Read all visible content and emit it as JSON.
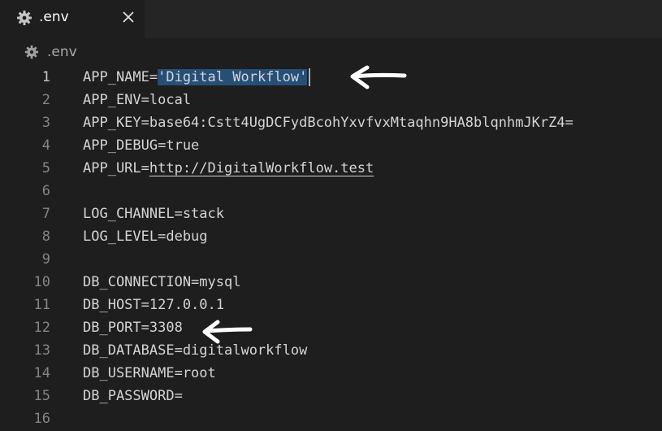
{
  "tab": {
    "title": ".env",
    "close_glyph": "✕",
    "icon": "gear-icon"
  },
  "breadcrumb": {
    "label": ".env",
    "icon": "gear-icon"
  },
  "editor": {
    "active_line": 1,
    "lines": [
      {
        "num": "1",
        "key": "APP_NAME=",
        "value": "'Digital Workflow'"
      },
      {
        "num": "2",
        "text": "APP_ENV=local"
      },
      {
        "num": "3",
        "text": "APP_KEY=base64:Cstt4UgDCFydBcohYxvfvxMtaqhn9HA8blqnhmJKrZ4="
      },
      {
        "num": "4",
        "text": "APP_DEBUG=true"
      },
      {
        "num": "5",
        "key": "APP_URL=",
        "value": "http://DigitalWorkflow.test"
      },
      {
        "num": "6",
        "text": ""
      },
      {
        "num": "7",
        "text": "LOG_CHANNEL=stack"
      },
      {
        "num": "8",
        "text": "LOG_LEVEL=debug"
      },
      {
        "num": "9",
        "text": ""
      },
      {
        "num": "10",
        "text": "DB_CONNECTION=mysql"
      },
      {
        "num": "11",
        "text": "DB_HOST=127.0.0.1"
      },
      {
        "num": "12",
        "text": "DB_PORT=3308"
      },
      {
        "num": "13",
        "text": "DB_DATABASE=digitalworkflow"
      },
      {
        "num": "14",
        "text": "DB_USERNAME=root"
      },
      {
        "num": "15",
        "text": "DB_PASSWORD="
      },
      {
        "num": "16",
        "text": ""
      }
    ]
  },
  "colors": {
    "background": "#1e1e1e",
    "tabbar": "#252526",
    "selection": "#264f78",
    "text": "#d4d4d4",
    "line_number": "#858585",
    "annotation_arrow": "#ffffff"
  }
}
